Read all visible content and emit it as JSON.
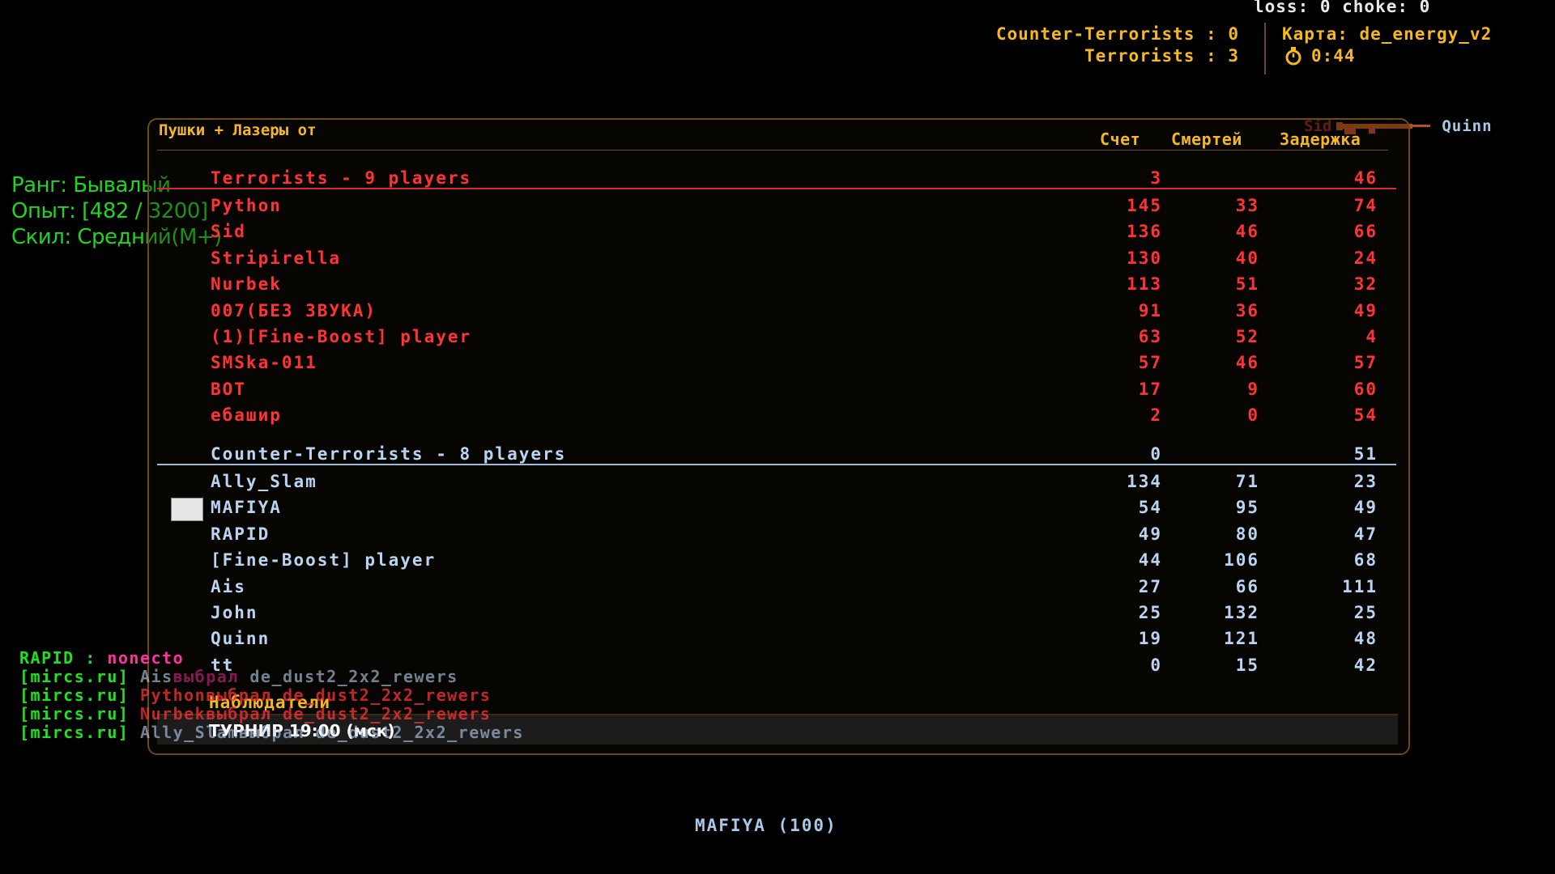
{
  "hud": {
    "netgraph": "loss: 0 choke:  0",
    "score_ct": "Counter-Terrorists : 0",
    "score_t": "Terrorists : 3",
    "map": "Карта: de_energy_v2",
    "timer": "0:44"
  },
  "killfeed": {
    "killer": "Sid",
    "victim": "Quinn"
  },
  "rank": {
    "line1": "Ранг: Бывалый",
    "line2": "Опыт: [482 / 3200]",
    "line3": "Скил: Средний(M+)"
  },
  "scoreboard": {
    "title": "Пушки + Лазеры от",
    "col_score": "Счет",
    "col_deaths": "Смертей",
    "col_ping": "Задержка",
    "terrorists": {
      "label": "Terrorists    -   9 players",
      "score": "3",
      "ping": "46",
      "players": [
        {
          "name": "Python",
          "score": "145",
          "deaths": "33",
          "ping": "74"
        },
        {
          "name": "Sid",
          "score": "136",
          "deaths": "46",
          "ping": "66"
        },
        {
          "name": "Stripirella",
          "score": "130",
          "deaths": "40",
          "ping": "24"
        },
        {
          "name": "Nurbek",
          "score": "113",
          "deaths": "51",
          "ping": "32"
        },
        {
          "name": "007(БЕЗ ЗВУКА)",
          "score": "91",
          "deaths": "36",
          "ping": "49"
        },
        {
          "name": "(1)[Fine-Boost] player",
          "score": "63",
          "deaths": "52",
          "ping": "4"
        },
        {
          "name": "SMSka-011",
          "score": "57",
          "deaths": "46",
          "ping": "57"
        },
        {
          "name": "BOT",
          "score": "17",
          "deaths": "9",
          "ping": "60"
        },
        {
          "name": "ебашир",
          "score": "2",
          "deaths": "0",
          "ping": "54"
        }
      ]
    },
    "cts": {
      "label": "Counter-Terrorists   -   8 players",
      "score": "0",
      "ping": "51",
      "players": [
        {
          "name": "Ally_Slam",
          "score": "134",
          "deaths": "71",
          "ping": "23"
        },
        {
          "name": "MAFIYA",
          "score": "54",
          "deaths": "95",
          "ping": "49"
        },
        {
          "name": "RAPID",
          "score": "49",
          "deaths": "80",
          "ping": "47"
        },
        {
          "name": "[Fine-Boost] player",
          "score": "44",
          "deaths": "106",
          "ping": "68"
        },
        {
          "name": "Ais",
          "score": "27",
          "deaths": "66",
          "ping": "111"
        },
        {
          "name": "John",
          "score": "25",
          "deaths": "132",
          "ping": "25"
        },
        {
          "name": "Quinn",
          "score": "19",
          "deaths": "121",
          "ping": "48"
        },
        {
          "name": "tt",
          "score": "0",
          "deaths": "15",
          "ping": "42"
        }
      ]
    },
    "spectators_label": "Наблюдатели",
    "server_message": "ТУРНИР 19:00 (мск)"
  },
  "chat": [
    {
      "tag": "RAPID :",
      "text": "nonecto"
    },
    {
      "tag": "[mircs.ru]",
      "nick": "Ais",
      "verb": "выбрал",
      "text": "de_dust2_2x2_rewers"
    },
    {
      "tag": "[mircs.ru]",
      "nick": "Python",
      "verb": "выбрал",
      "text": "de_dust2_2x2_rewers"
    },
    {
      "tag": "[mircs.ru]",
      "nick": "Nurbek",
      "verb": "выбрал",
      "text": "de_dust2_2x2_rewers"
    },
    {
      "tag": "[mircs.ru]",
      "nick": "Ally_Slam",
      "verb": "выбрал",
      "text": "de_dust2_2x2_rewers"
    }
  ],
  "spectating": "MAFIYA (100)",
  "colors": {
    "terrorist": "#ff3333",
    "counter_terrorist": "#b9d4f2",
    "hud_yellow": "#f5b81f",
    "rank_green": "#1fd51f"
  }
}
